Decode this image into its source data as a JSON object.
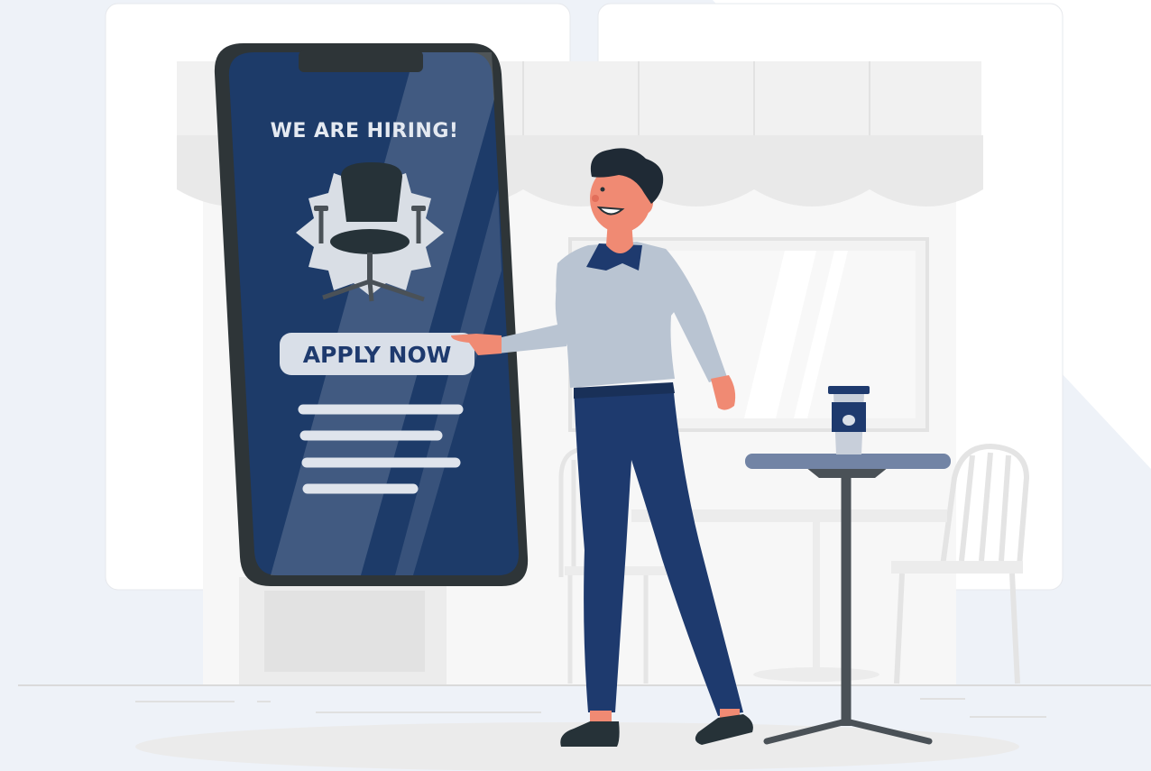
{
  "phone_screen": {
    "headline": "WE ARE HIRING!",
    "cta_label": "APPLY NOW"
  },
  "colors": {
    "navy": "#1e3a6e",
    "screen_blue": "#1d3b69",
    "sweater": "#b9c4d2",
    "skin": "#f08a73",
    "hair": "#1f2a35",
    "dark_gray": "#4a5157",
    "background_tint": "#eef2f8"
  },
  "icons": [
    "office-chair-icon",
    "badge-burst-icon",
    "coffee-cup-icon"
  ]
}
